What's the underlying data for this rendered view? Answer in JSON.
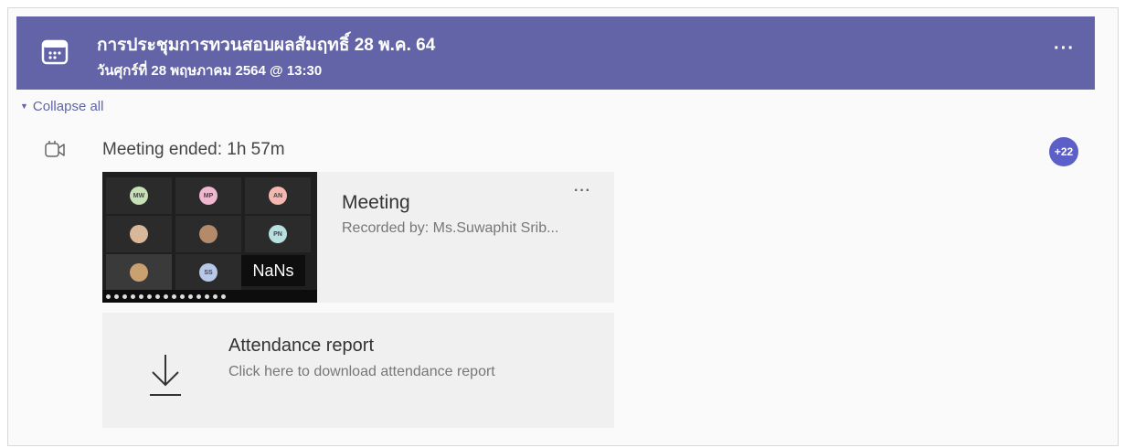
{
  "header": {
    "title": "การประชุมการทวนสอบผลสัมฤทธิ์ 28 พ.ค. 64",
    "subtitle": "วันศุกร์ที่ 28 พฤษภาคม 2564 @ 13:30",
    "more_label": "···",
    "icon": "calendar-icon",
    "bg_color": "#6264a7"
  },
  "collapse_label": "Collapse all",
  "meeting_status": {
    "icon": "video-camera-icon",
    "text": "Meeting ended: 1h 57m",
    "participants_badge": "+22"
  },
  "recording": {
    "title": "Meeting",
    "recorded_by": "Recorded by: Ms.Suwaphit Srib...",
    "more_label": "···",
    "thumbnail_label": "NaNs",
    "thumbnail_tiles": [
      {
        "initials": "MW",
        "color": "#c7e0b8"
      },
      {
        "initials": "MP",
        "color": "#f0b8d0"
      },
      {
        "initials": "AN",
        "color": "#f4b8b0"
      },
      {
        "initials": "",
        "color": "#d9b89a"
      },
      {
        "initials": "",
        "color": "#b38a6a"
      },
      {
        "initials": "PN",
        "color": "#b8e0e0"
      },
      {
        "initials": "",
        "color": "#c9a070"
      },
      {
        "initials": "SS",
        "color": "#b8c8e8"
      }
    ]
  },
  "attendance": {
    "title": "Attendance report",
    "subtitle": "Click here to download attendance report",
    "icon": "download-arrow-icon"
  }
}
